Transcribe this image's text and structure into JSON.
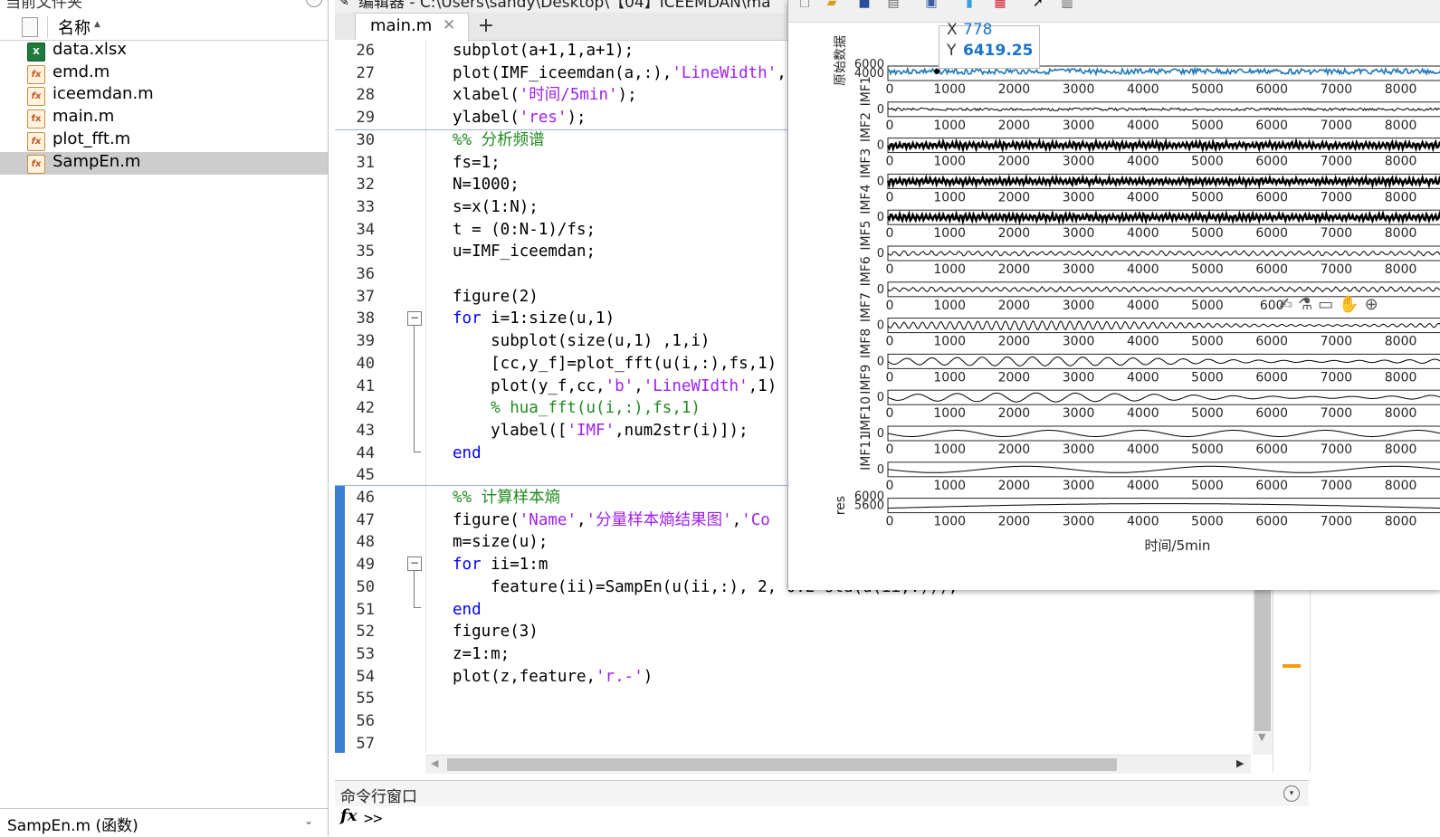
{
  "file_browser": {
    "title": "当前文件夹",
    "column_name": "名称",
    "files": [
      {
        "name": "data.xlsx",
        "type": "xlsx",
        "selected": false
      },
      {
        "name": "emd.m",
        "type": "m",
        "selected": false
      },
      {
        "name": "iceemdan.m",
        "type": "m",
        "selected": false
      },
      {
        "name": "main.m",
        "type": "mlx",
        "selected": false
      },
      {
        "name": "plot_fft.m",
        "type": "m",
        "selected": false
      },
      {
        "name": "SampEn.m",
        "type": "m",
        "selected": true
      }
    ],
    "details_label": "SampEn.m (函数)"
  },
  "editor": {
    "header": "编辑器 - C:\\Users\\sandy\\Desktop\\【04】ICEEMDAN\\ma",
    "tab": "main.m",
    "lines": [
      {
        "n": "26",
        "code": [
          [
            "n",
            "subplot(a+1,1,a+1);"
          ]
        ]
      },
      {
        "n": "27",
        "code": [
          [
            "n",
            "plot(IMF_iceemdan(a,:),"
          ],
          [
            "s",
            "'LineWidth'"
          ],
          [
            "n",
            ","
          ]
        ]
      },
      {
        "n": "28",
        "code": [
          [
            "n",
            "xlabel("
          ],
          [
            "s",
            "'时间/5min'"
          ],
          [
            "n",
            ");"
          ]
        ]
      },
      {
        "n": "29",
        "code": [
          [
            "n",
            "ylabel("
          ],
          [
            "s",
            "'res'"
          ],
          [
            "n",
            ");"
          ]
        ]
      },
      {
        "n": "30",
        "code": [
          [
            "c",
            "%% 分析频谱"
          ]
        ]
      },
      {
        "n": "31",
        "code": [
          [
            "n",
            "fs=1;"
          ]
        ]
      },
      {
        "n": "32",
        "code": [
          [
            "n",
            "N=1000;"
          ]
        ]
      },
      {
        "n": "33",
        "code": [
          [
            "n",
            "s=x(1:N);"
          ]
        ]
      },
      {
        "n": "34",
        "code": [
          [
            "n",
            "t = (0:N-1)/fs;"
          ]
        ]
      },
      {
        "n": "35",
        "code": [
          [
            "n",
            "u=IMF_iceemdan;"
          ]
        ]
      },
      {
        "n": "36",
        "code": []
      },
      {
        "n": "37",
        "code": [
          [
            "n",
            "figure(2)"
          ]
        ]
      },
      {
        "n": "38",
        "code": [
          [
            "k",
            "for"
          ],
          [
            "n",
            " i=1:size(u,1)"
          ]
        ]
      },
      {
        "n": "39",
        "code": [
          [
            "n",
            "    subplot(size(u,1) ,1,i)"
          ]
        ]
      },
      {
        "n": "40",
        "code": [
          [
            "n",
            "    [cc,y_f]=plot_fft(u(i,:),fs,1)"
          ]
        ]
      },
      {
        "n": "41",
        "code": [
          [
            "n",
            "    plot(y_f,cc,"
          ],
          [
            "s",
            "'b'"
          ],
          [
            "n",
            ","
          ],
          [
            "s",
            "'LineWIdth'"
          ],
          [
            "n",
            ",1)"
          ]
        ]
      },
      {
        "n": "42",
        "code": [
          [
            "c",
            "    % hua_fft(u(i,:),fs,1)"
          ]
        ]
      },
      {
        "n": "43",
        "code": [
          [
            "n",
            "    ylabel(["
          ],
          [
            "s",
            "'IMF'"
          ],
          [
            "n",
            ",num2str(i)]);"
          ]
        ]
      },
      {
        "n": "44",
        "code": [
          [
            "k",
            "end"
          ]
        ]
      },
      {
        "n": "45",
        "code": []
      },
      {
        "n": "46",
        "code": [
          [
            "c",
            "%% 计算样本熵"
          ]
        ]
      },
      {
        "n": "47",
        "code": [
          [
            "n",
            "figure("
          ],
          [
            "s",
            "'Name'"
          ],
          [
            "n",
            ","
          ],
          [
            "s",
            "'分量样本熵结果图'"
          ],
          [
            "n",
            ","
          ],
          [
            "s",
            "'Co"
          ]
        ]
      },
      {
        "n": "48",
        "code": [
          [
            "n",
            "m=size(u);"
          ]
        ]
      },
      {
        "n": "49",
        "code": [
          [
            "k",
            "for"
          ],
          [
            "n",
            " ii=1:m"
          ]
        ]
      },
      {
        "n": "50",
        "code": [
          [
            "n",
            "    feature(ii)=SampEn(u(ii,:), 2, 0.2*std(u(ii,:)));"
          ]
        ]
      },
      {
        "n": "51",
        "code": [
          [
            "k",
            "end"
          ]
        ]
      },
      {
        "n": "52",
        "code": [
          [
            "n",
            "figure(3)"
          ]
        ]
      },
      {
        "n": "53",
        "code": [
          [
            "n",
            "z=1:m;"
          ]
        ]
      },
      {
        "n": "54",
        "code": [
          [
            "n",
            "plot(z,feature,"
          ],
          [
            "s",
            "'r.-'"
          ],
          [
            "n",
            ")"
          ]
        ]
      },
      {
        "n": "55",
        "code": []
      },
      {
        "n": "56",
        "code": []
      },
      {
        "n": "57",
        "code": []
      }
    ]
  },
  "command_window": {
    "title": "命令行窗口",
    "fx": "fx",
    "prompt": ">>"
  },
  "figure": {
    "toolbar_icons": [
      "new-file-icon",
      "open-folder-icon",
      "save-icon",
      "print-icon",
      "print-preview-icon",
      "colorbar-icon",
      "legend-icon",
      "pointer-icon",
      "panel-icon"
    ],
    "datatip": {
      "x_label": "X",
      "x_value": "778",
      "y_label": "Y",
      "y_value": "6419.25"
    },
    "axes_toolbar_icons": [
      "brush-icon",
      "data-cursor-icon",
      "datatip-icon",
      "pan-icon",
      "zoom-in-icon"
    ],
    "x_ticks": [
      "0",
      "1000",
      "2000",
      "3000",
      "4000",
      "5000",
      "6000",
      "7000",
      "8000"
    ],
    "x_ticks_partial": [
      "0",
      "1000",
      "2000",
      "3000",
      "4000",
      "5000",
      "600"
    ],
    "xlabel_mid": "时间/5min",
    "xlabel_bottom": "时间/5min",
    "subplots": [
      {
        "ylabel": "原始数据",
        "yticks": [
          "6000",
          "4000"
        ],
        "style": "dense",
        "color": "#1f77b4"
      },
      {
        "ylabel": "IMF1",
        "yticks": [
          "0"
        ],
        "style": "noise",
        "color": "#000000"
      },
      {
        "ylabel": "IMF2",
        "yticks": [
          "0"
        ],
        "style": "thick",
        "color": "#000000"
      },
      {
        "ylabel": "IMF3",
        "yticks": [
          "0"
        ],
        "style": "thick",
        "color": "#000000"
      },
      {
        "ylabel": "IMF4",
        "yticks": [
          "0"
        ],
        "style": "thick",
        "color": "#000000"
      },
      {
        "ylabel": "IMF5",
        "yticks": [
          "0"
        ],
        "style": "med",
        "color": "#000000"
      },
      {
        "ylabel": "IMF6",
        "yticks": [
          "0"
        ],
        "style": "med",
        "color": "#000000"
      },
      {
        "ylabel": "IMF7",
        "yticks": [
          "0"
        ],
        "style": "wave",
        "color": "#000000"
      },
      {
        "ylabel": "IMF8",
        "yticks": [
          "0"
        ],
        "style": "wave",
        "color": "#000000"
      },
      {
        "ylabel": "IMF9",
        "yticks": [
          "0"
        ],
        "style": "wave",
        "color": "#000000"
      },
      {
        "ylabel": "IMF10",
        "yticks": [
          "0"
        ],
        "style": "slow",
        "color": "#000000"
      },
      {
        "ylabel": "IMF11",
        "yticks": [
          "0"
        ],
        "style": "slow",
        "color": "#000000"
      },
      {
        "ylabel": "res",
        "yticks": [
          "6000",
          "5600"
        ],
        "style": "trend",
        "color": "#000000"
      }
    ]
  }
}
